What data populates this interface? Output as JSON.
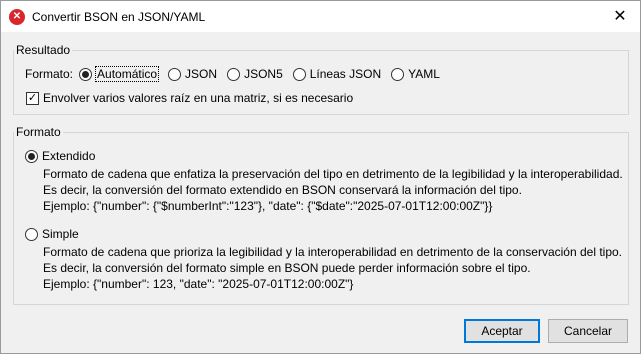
{
  "window": {
    "title": "Convertir BSON en JSON/YAML",
    "icon": "app-error-icon",
    "accent": "#0078d7"
  },
  "result_group": {
    "legend": "Resultado",
    "format_label": "Formato:",
    "options": [
      "Automático",
      "JSON",
      "JSON5",
      "Líneas JSON",
      "YAML"
    ],
    "selected": "Automático",
    "wrap_checkbox": {
      "label": "Envolver varios valores raíz en una matriz, si es necesario",
      "checked": true
    }
  },
  "format_group": {
    "legend": "Formato",
    "extended": {
      "label": "Extendido",
      "checked": true,
      "lines": [
        "Formato de cadena que enfatiza la preservación del tipo en detrimento de la legibilidad y la interoperabilidad.",
        "Es decir, la conversión del formato extendido en BSON conservará la información del tipo.",
        "Ejemplo: {\"number\": {\"$numberInt\":\"123\"}, \"date\": {\"$date\":\"2025-07-01T12:00:00Z\"}}"
      ]
    },
    "simple": {
      "label": "Simple",
      "checked": false,
      "lines": [
        "Formato de cadena que prioriza la legibilidad y la interoperabilidad en detrimento de la conservación del tipo.",
        "Es decir, la conversión del formato simple en BSON puede perder información sobre el tipo.",
        "Ejemplo: {\"number\": 123, \"date\": \"2025-07-01T12:00:00Z\"}"
      ]
    }
  },
  "buttons": {
    "ok": "Aceptar",
    "cancel": "Cancelar"
  }
}
